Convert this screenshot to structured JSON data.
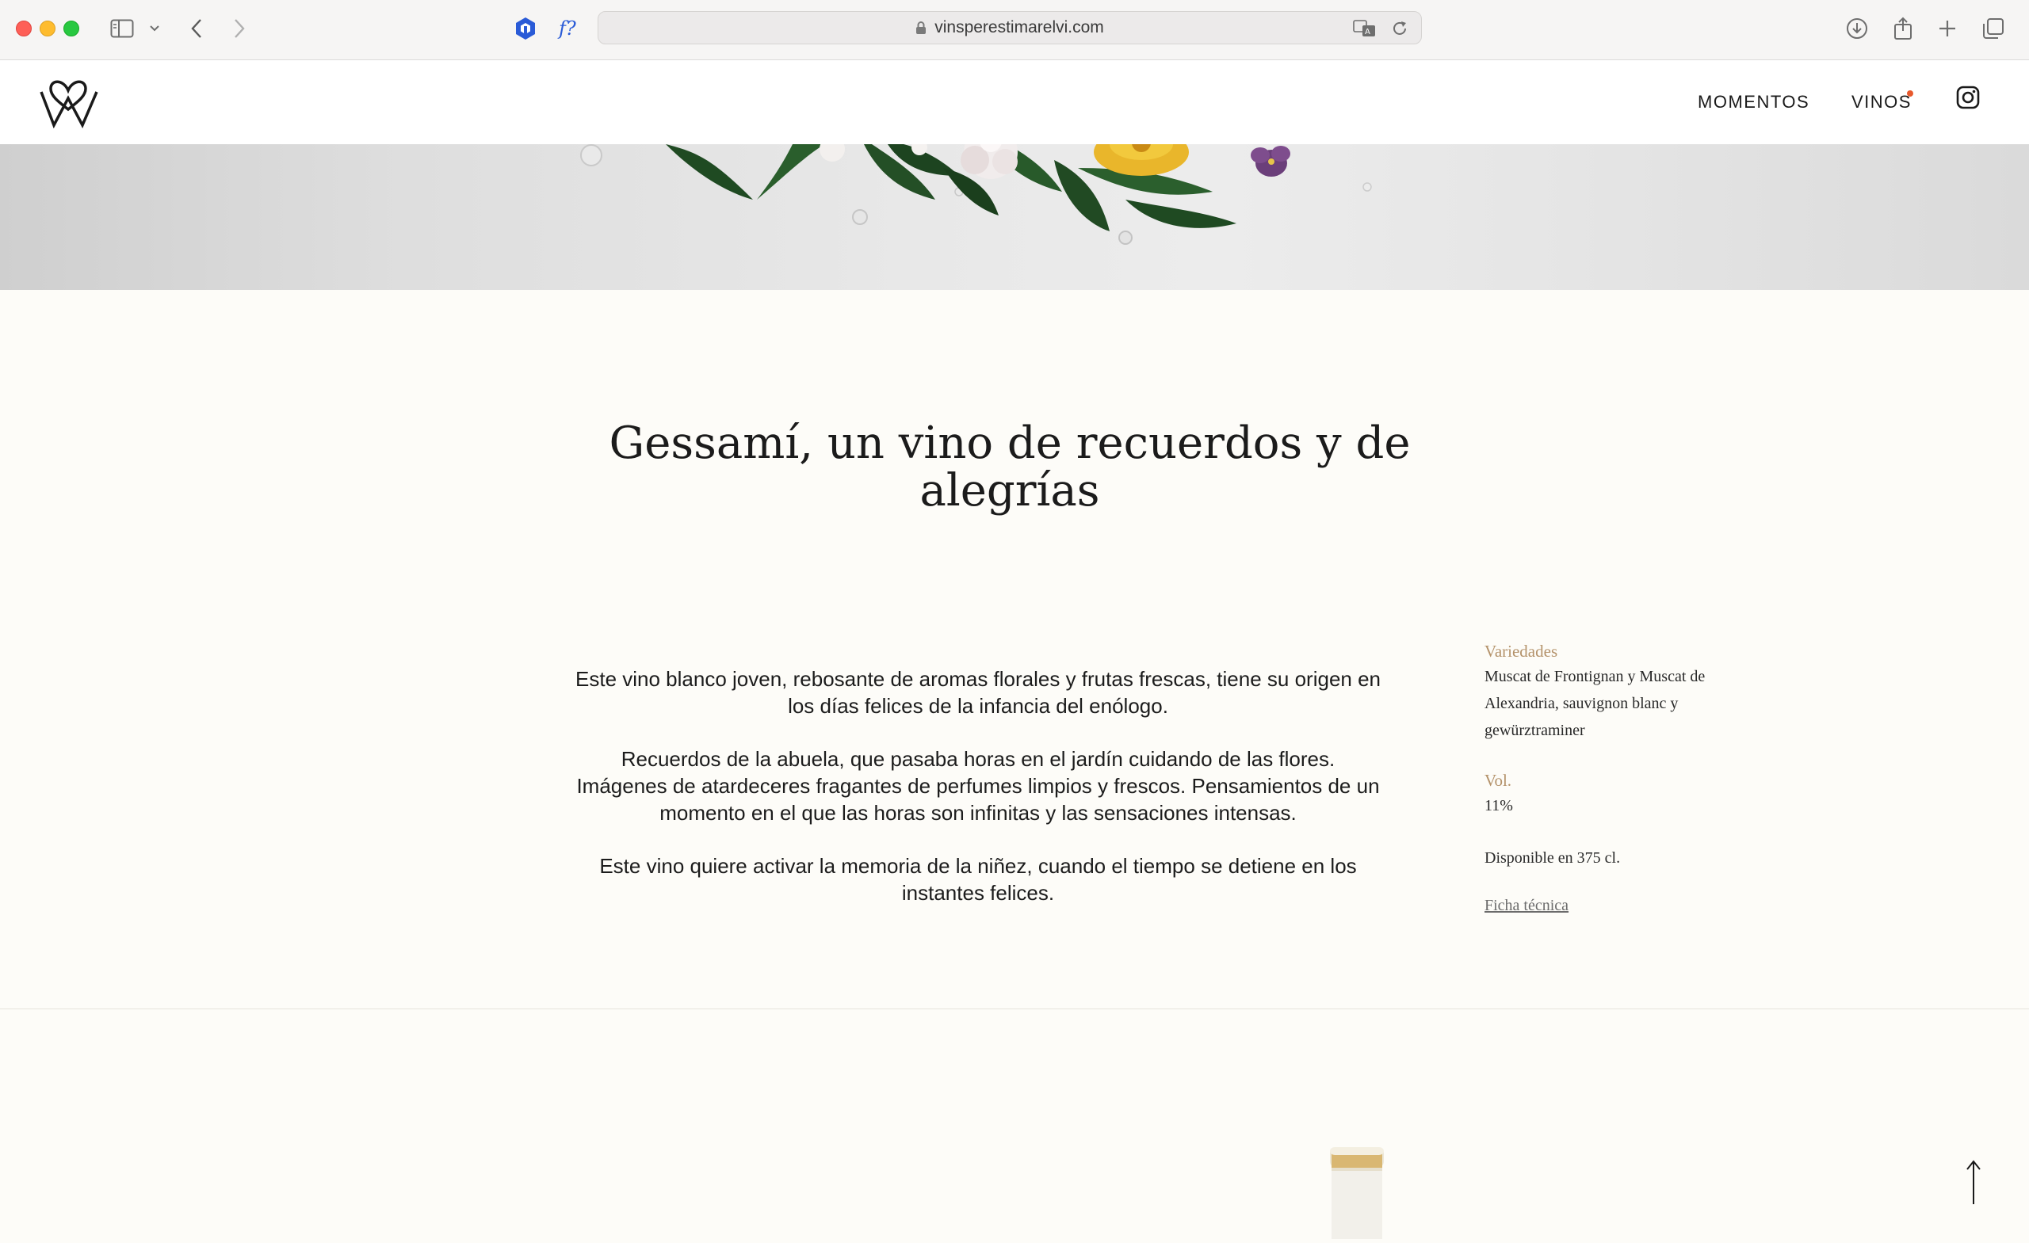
{
  "browser": {
    "url": "vinsperestimarelvi.com"
  },
  "site": {
    "nav": {
      "momentos": "MOMENTOS",
      "vinos": "VINOS"
    },
    "accent_color": "#e8592c"
  },
  "main": {
    "title": "Gessamí, un vino de recuerdos y de alegrías",
    "paragraphs": [
      "Este vino blanco joven, rebosante de aromas florales y frutas frescas, tiene su origen en los días felices de la infancia del enólogo.",
      "Recuerdos de la abuela, que pasaba horas en el jardín cuidando de las flores. Imágenes de atardeceres fragantes de perfumes limpios y frescos. Pensamientos de un momento en el que las horas son infinitas y las sensaciones intensas.",
      "Este vino quiere activar la memoria de la niñez, cuando el tiempo se detiene en los instantes felices."
    ]
  },
  "specs": {
    "varieties_label": "Variedades",
    "varieties_value": "Muscat de Frontignan y Muscat de Alexandria, sauvignon blanc y gewürztraminer",
    "vol_label": "Vol.",
    "vol_value": "11%",
    "availability": "Disponible en 375 cl.",
    "datasheet_link": "Ficha técnica",
    "label_color": "#b4926a"
  }
}
